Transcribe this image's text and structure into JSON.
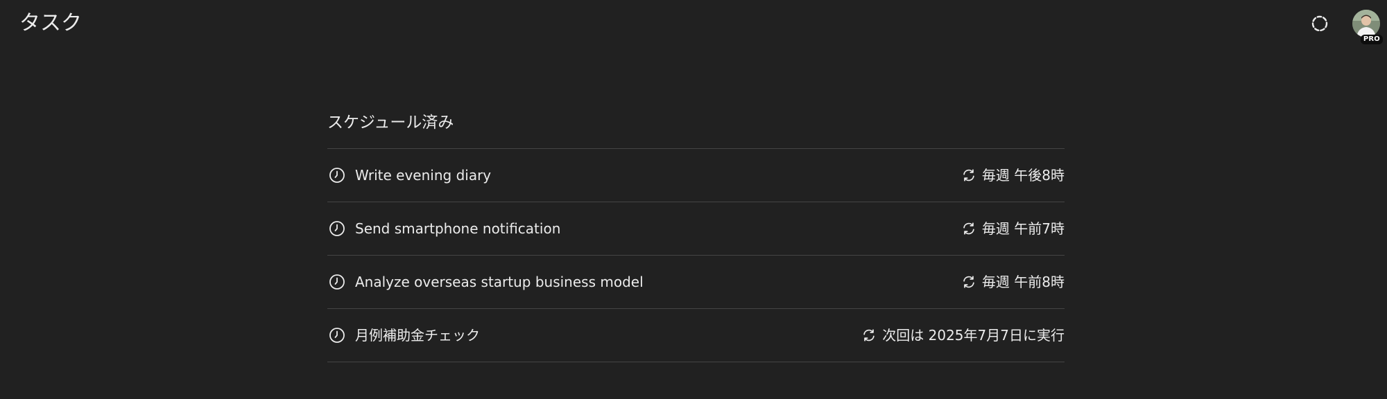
{
  "header": {
    "title": "タスク",
    "tasks_icon": "dashed-circle-icon",
    "avatar_badge": "PRO"
  },
  "section": {
    "title": "スケジュール済み"
  },
  "tasks": [
    {
      "name": "Write evening diary",
      "schedule": "毎週 午後8時",
      "icon": "clock-icon",
      "schedule_icon": "repeat-icon"
    },
    {
      "name": "Send smartphone notification",
      "schedule": "毎週 午前7時",
      "icon": "clock-icon",
      "schedule_icon": "repeat-icon"
    },
    {
      "name": "Analyze overseas startup business model",
      "schedule": "毎週 午前8時",
      "icon": "clock-icon",
      "schedule_icon": "repeat-icon"
    },
    {
      "name": "月例補助金チェック",
      "schedule": "次回は 2025年7月7日に実行",
      "icon": "clock-icon",
      "schedule_icon": "repeat-icon"
    }
  ],
  "colors": {
    "background": "#212121",
    "text": "#ececec",
    "divider": "#454545"
  }
}
